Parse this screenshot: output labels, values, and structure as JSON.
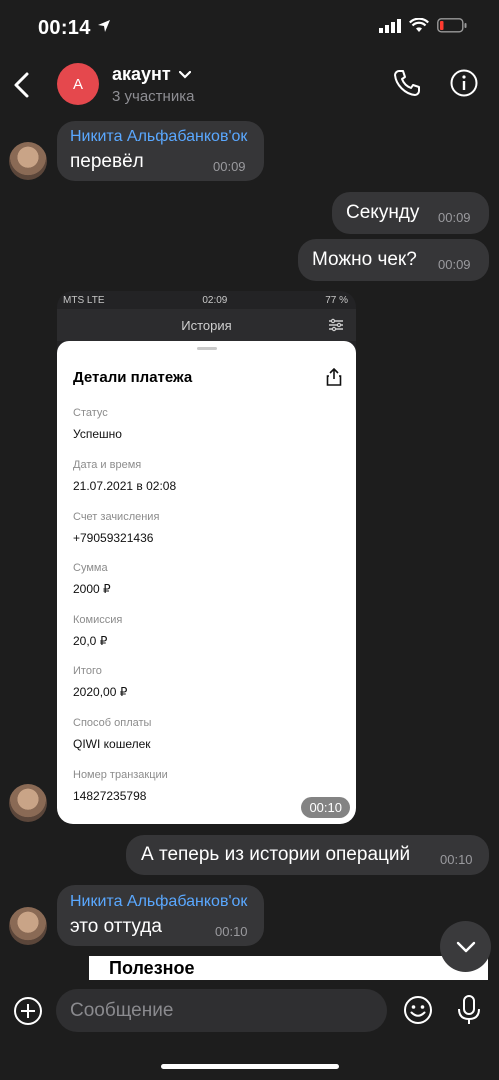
{
  "status_bar": {
    "time": "00:14"
  },
  "header": {
    "avatar_letter": "А",
    "title": "акаунт",
    "subtitle": "3 участника"
  },
  "messages": [
    {
      "sender": "Никита Альфабанков'ок",
      "text": "перевёл",
      "time": "00:09"
    },
    {
      "text": "Секунду",
      "time": "00:09"
    },
    {
      "text": "Можно чек?",
      "time": "00:09"
    },
    {
      "text": "А теперь из истории операций",
      "time": "00:10"
    },
    {
      "sender": "Никита Альфабанков'ок",
      "text": "это оттуда",
      "time": "00:10"
    }
  ],
  "receipt": {
    "carrier": "MTS LTE",
    "clock": "02:09",
    "battery": "77 %",
    "screen_title": "История",
    "card_title": "Детали платежа",
    "fields": [
      {
        "label": "Статус",
        "value": "Успешно"
      },
      {
        "label": "Дата и время",
        "value": "21.07.2021 в 02:08"
      },
      {
        "label": "Счет зачисления",
        "value": "+79059321436"
      },
      {
        "label": "Сумма",
        "value": "2000 ₽"
      },
      {
        "label": "Комиссия",
        "value": "20,0 ₽"
      },
      {
        "label": "Итого",
        "value": "2020,00 ₽"
      },
      {
        "label": "Способ оплаты",
        "value": "QIWI кошелек"
      },
      {
        "label": "Номер транзакции",
        "value": "14827235798"
      }
    ],
    "time": "00:10"
  },
  "peek_text": "Полезное",
  "composer": {
    "placeholder": "Сообщение"
  },
  "colors": {
    "accent_link": "#5aa8ff",
    "avatar": "#e5484d",
    "bubble": "#363638",
    "background": "#1d1d1d"
  }
}
